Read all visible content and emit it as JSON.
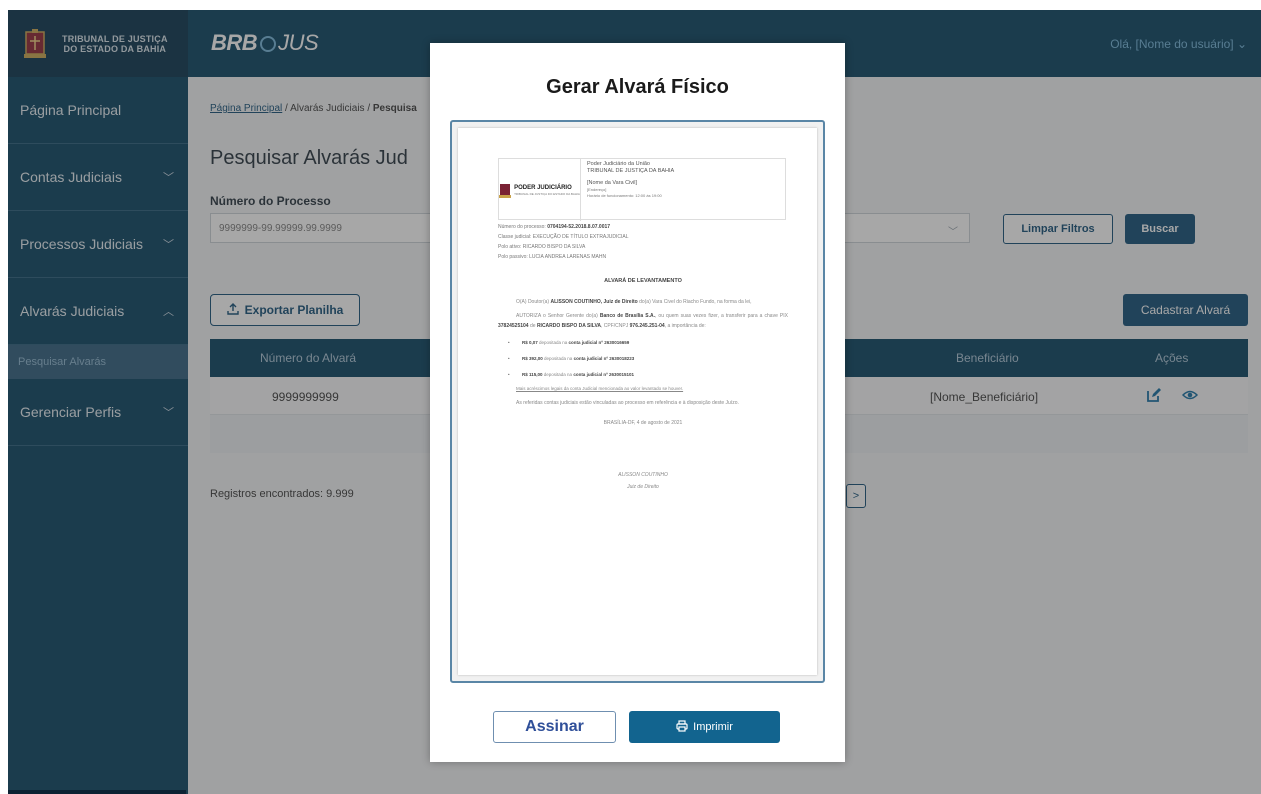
{
  "header": {
    "org_line1": "TRIBUNAL DE JUSTIÇA",
    "org_line2": "DO ESTADO DA BAHIA",
    "brand_brb": "BRB",
    "brand_jus": "JUS",
    "user_greeting": "Olá, [Nome do usuário] ⌄"
  },
  "sidebar": {
    "items": [
      {
        "label": "Página Principal"
      },
      {
        "label": "Contas Judiciais"
      },
      {
        "label": "Processos Judiciais"
      },
      {
        "label": "Alvarás Judiciais"
      },
      {
        "label": "Gerenciar Perfis"
      }
    ],
    "sub_item": "Pesquisar Alvarás"
  },
  "main": {
    "breadcrumb": {
      "home": "Página Principal",
      "sep1": " / ",
      "section": "Alvarás Judiciais",
      "sep2": " / ",
      "current": "Pesquisa"
    },
    "page_title": "Pesquisar Alvarás Jud",
    "field_label": "Número do Processo",
    "field_placeholder": "9999999-99.99999.99.9999",
    "clear_button": "Limpar Filtros",
    "search_button": "Buscar",
    "export_button": "Exportar Planilha",
    "register_button": "Cadastrar Alvará",
    "table": {
      "headers": [
        "Número do Alvará",
        "Beneficiário",
        "Ações"
      ],
      "rows": [
        {
          "numero": "9999999999",
          "beneficiario": "[Nome_Beneficiário]"
        }
      ]
    },
    "records_text": "Registros encontrados: 9.999",
    "pager_next": ">"
  },
  "modal": {
    "title": "Gerar Alvará Físico",
    "sign_button": "Assinar",
    "print_button": "Imprimir",
    "document": {
      "logo_text": "PODER JUDICIÁRIO",
      "logo_sub": "TRIBUNAL DE JUSTIÇA DO ESTADO DA BAHIA",
      "head_line1": "Poder Judiciário da União",
      "head_line2": "TRIBUNAL DE JUSTIÇA DA BAHIA",
      "vara": "[Nome da Vara Civil]",
      "endereco": "[Endereço]",
      "horario": "Horário de funcionamento: 12:00 às 19:00",
      "processo_label": "Número do processo: ",
      "processo_value": "0704194-52.2018.8.07.0017",
      "classe": "Classe judicial: EXECUÇÃO DE TÍTULO EXTRAJUDICIAL",
      "polo_ativo": "Polo ativo: RICARDO BISPO DA SILVA",
      "polo_passivo": "Polo passivo: LUCIA ANDREA LARENAS MAHN",
      "heading": "ALVARÁ DE LEVANTAMENTO",
      "p1_a": "O(A) Doutor(a) ",
      "p1_b": "ALISSON COUTINHO, Juiz de Direito",
      "p1_c": " do(a) Vara Civel do Riacho Fundo, na forma da lei,",
      "p2_a": "AUTORIZA o Senhor Gerente do(a) ",
      "p2_b": "Banco de Brasília S.A.",
      "p2_c": ", ou quem suas vezes fizer, a transferir para a chave PIX ",
      "p2_d": "37824525104",
      "p2_e": " de ",
      "p2_f": "RICARDO BISPO DA SILVA",
      "p2_g": ", CPF/CNPJ ",
      "p2_h": "976.245.251-04",
      "p2_i": ", a importância de:",
      "items": [
        {
          "valor": "R$ 0,07",
          "texto": " depositada na ",
          "conta": "conta judicial nº 2630016659"
        },
        {
          "valor": "R$ 392,00",
          "texto": " depositada na ",
          "conta": "conta judicial nº 2630018223"
        },
        {
          "valor": "R$ 115,00",
          "texto": " depositada na ",
          "conta": "conta judicial nº 2630015101"
        }
      ],
      "acrescimos": "Mais acréscimos legais da conta Judicial mencionada ao valor levantado se houver.",
      "vinculadas": "As referidas contas judiciais estão vinculadas ao processo em referência e à disposição deste Juízo.",
      "local_data": "BRASÍLIA-DF, 4 de agosto de 2021",
      "sign_name": "ALISSON COUTINHO",
      "sign_role": "Juiz de Direito"
    }
  }
}
